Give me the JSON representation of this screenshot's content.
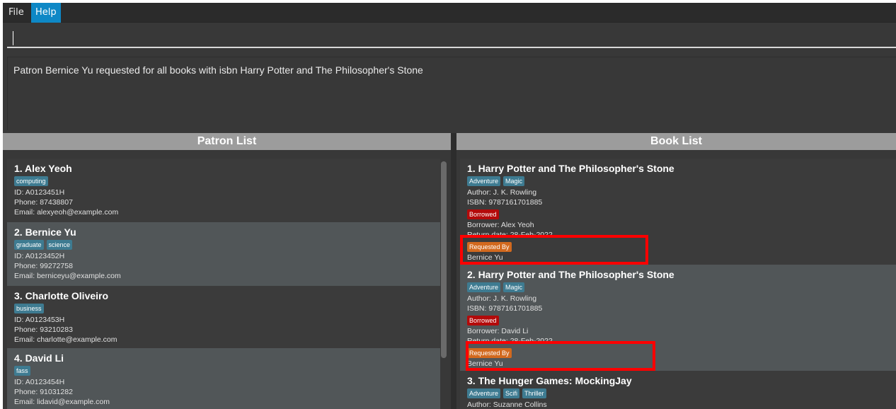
{
  "menu": {
    "items": [
      {
        "label": "File",
        "active": false
      },
      {
        "label": "Help",
        "active": true
      }
    ]
  },
  "command": {
    "value": "",
    "result": "Patron Bernice Yu requested for all books with isbn Harry Potter and The Philosopher's Stone"
  },
  "patron_list": {
    "header": "Patron List",
    "items": [
      {
        "title": "1.  Alex Yeoh",
        "tags": [
          "computing"
        ],
        "id": "ID: A0123451H",
        "phone": "Phone: 87438807",
        "email": "Email: alexyeoh@example.com"
      },
      {
        "title": "2.  Bernice Yu",
        "tags": [
          "graduate",
          "science"
        ],
        "id": "ID: A0123452H",
        "phone": "Phone: 99272758",
        "email": "Email: berniceyu@example.com"
      },
      {
        "title": "3.  Charlotte Oliveiro",
        "tags": [
          "business"
        ],
        "id": "ID: A0123453H",
        "phone": "Phone: 93210283",
        "email": "Email: charlotte@example.com"
      },
      {
        "title": "4.  David Li",
        "tags": [
          "fass"
        ],
        "id": "ID: A0123454H",
        "phone": "Phone: 91031282",
        "email": "Email: lidavid@example.com"
      }
    ]
  },
  "book_list": {
    "header": "Book List",
    "items": [
      {
        "title": "1.  Harry Potter and The Philosopher's Stone",
        "tags": [
          "Adventure",
          "Magic"
        ],
        "author": "Author: J. K. Rowling",
        "isbn": "ISBN: 9787161701885",
        "status": "Borrowed",
        "borrower": "Borrower: Alex Yeoh",
        "return_date": "Return date: 28-Feb-2022",
        "requested_label": "Requested By",
        "requested_by": "Bernice Yu"
      },
      {
        "title": "2.  Harry Potter and The Philosopher's Stone",
        "tags": [
          "Adventure",
          "Magic"
        ],
        "author": "Author: J. K. Rowling",
        "isbn": "ISBN: 9787161701885",
        "status": "Borrowed",
        "borrower": "Borrower: David Li",
        "return_date": "Return date: 28-Feb-2022",
        "requested_label": "Requested By",
        "requested_by": "Bernice Yu"
      },
      {
        "title": "3.  The Hunger Games: MockingJay",
        "tags": [
          "Adventure",
          "Scifi",
          "Thriller"
        ],
        "author": "Author: Suzanne Collins"
      }
    ]
  },
  "colors": {
    "accent": "#0e88c6",
    "tag": "#3e7b91",
    "borrowed": "#b30a0a",
    "requested": "#d2691e",
    "highlight": "#ff0000"
  }
}
